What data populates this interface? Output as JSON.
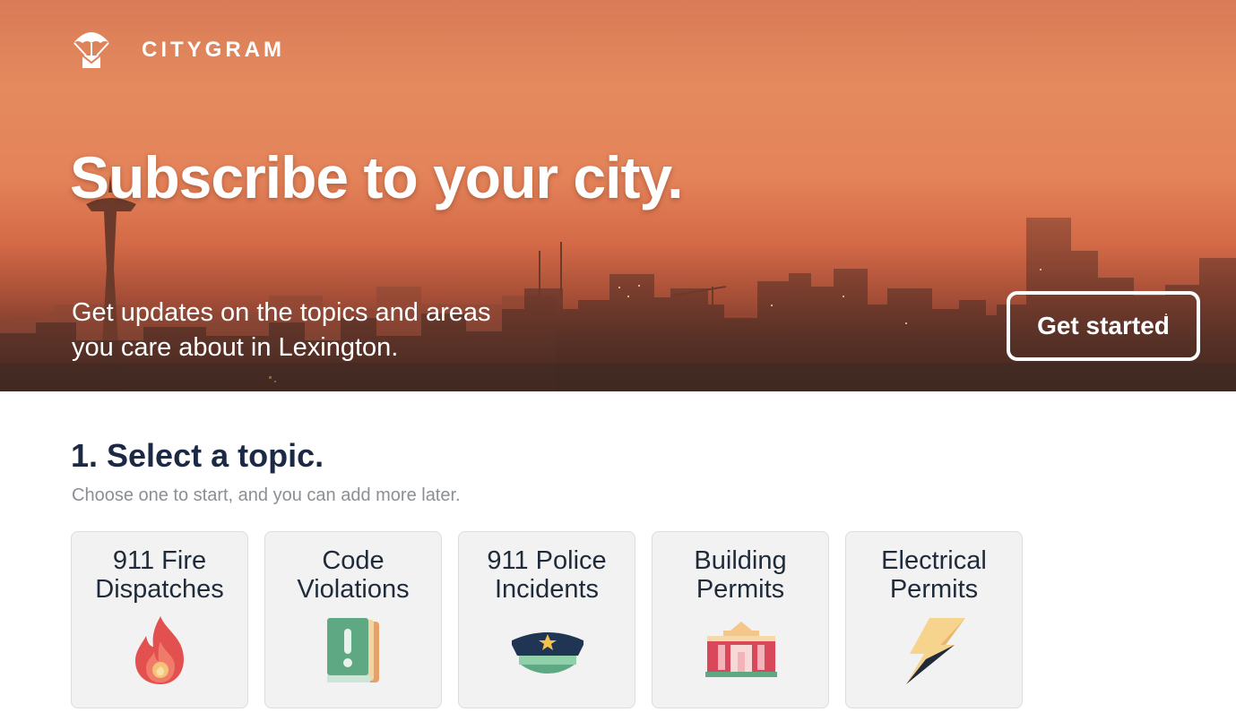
{
  "hero": {
    "brand": "CITYGRAM",
    "title": "Subscribe to your city.",
    "subtitle": "Get updates on the topics and areas you care about in Lexington.",
    "cta_label": "Get started"
  },
  "topics_section": {
    "title": "1. Select a topic.",
    "subtitle": "Choose one to start, and you can add more later.",
    "items": [
      {
        "label": "911 Fire\nDispatches",
        "icon": "fire-icon"
      },
      {
        "label": "Code\nViolations",
        "icon": "book-exclamation-icon"
      },
      {
        "label": "911 Police\nIncidents",
        "icon": "police-cap-icon"
      },
      {
        "label": "Building\nPermits",
        "icon": "building-icon"
      },
      {
        "label": "Electrical\nPermits",
        "icon": "lightning-icon"
      }
    ]
  },
  "colors": {
    "hero_orange": "#e48a5e",
    "heading_navy": "#1c2945",
    "muted_gray": "#8b8f94",
    "card_bg": "#f2f2f2"
  }
}
